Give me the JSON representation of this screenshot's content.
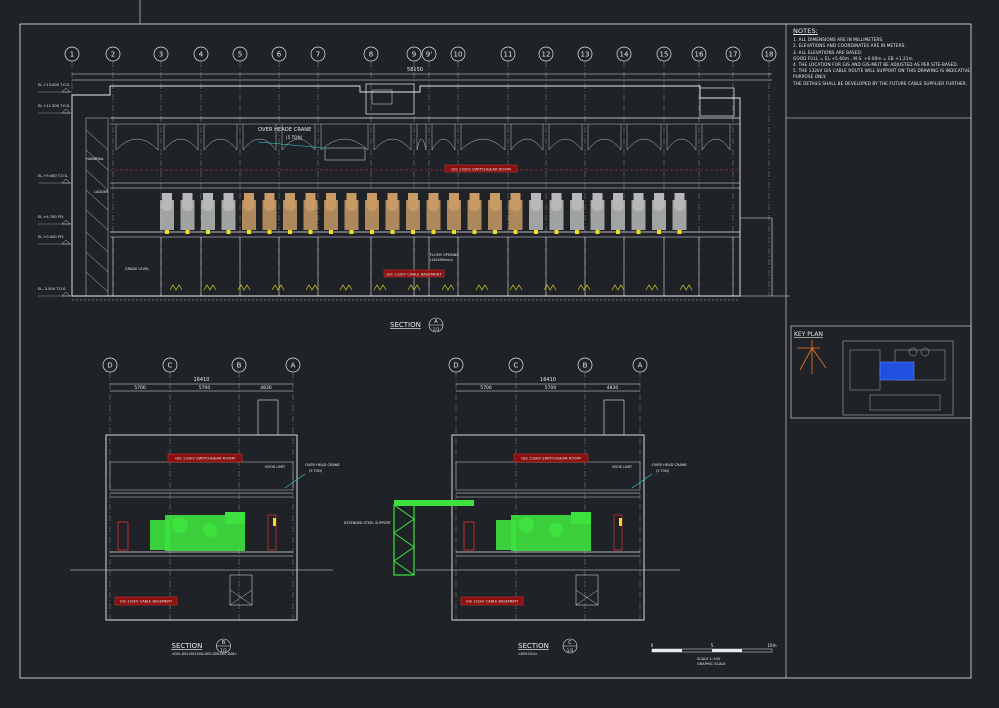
{
  "notes": {
    "heading": "NOTES:",
    "lines": [
      "1. ALL DIMENSIONS ARE IN MILLIMETERS.",
      "2. ELEVATIONS AND COORDINATES ARE IN METERS.",
      "3. ALL ELEVATIONS ARE BASED:",
      "   GOOD FULL = EL.+5.60m , M.S. +0.00m = EB +1.21m",
      "4. THE LOCATION FOR GIS AND GIS-MEIT BE ADJUSTED AS PER SITE-BASED.",
      "5. THE 132kV GIS CABLE ROUTE WILL SUPPORT ON THIS DRAWING IS INDICATIVE",
      "   PURPOSE ONLY.",
      "   THE DETAILS SHALL BE DEVELOPED BY THE FUTURE CABLE SUPPLIER FURTHER."
    ]
  },
  "key_plan": {
    "title": "KEY PLAN"
  },
  "section_a": {
    "grid": [
      "1",
      "2",
      "3",
      "4",
      "5",
      "6",
      "7",
      "8",
      "9",
      "9'",
      "10",
      "11",
      "12",
      "13",
      "14",
      "15",
      "16",
      "17",
      "18"
    ],
    "overall_dim": "58150",
    "title": "SECTION",
    "mark": "A",
    "sheet": "1/3",
    "crane_label": "OVER HEADE CRANE",
    "crane_capacity": "(5 TON)",
    "room_label": "GIS 132kV SWITCHGEAR ROOM",
    "basement_label": "GIS 132kV CABLE BASEMENT",
    "grade_label": "GRADE LEVEL",
    "handrail_label": "HANDRAIL",
    "ladder_label": "LADDER",
    "floor_opening_label": "FLOOR OPENING",
    "floor_opening_size": "(150x500mm)",
    "levels": [
      "EL.+13.000 T.O.S.",
      "EL.+11.300 T.O.S.",
      "EL.+9.450 T.O.S.",
      "EL.+4.700 FFL",
      "EL.+0.000 FFL",
      "EL.-3.500 T.O.S."
    ]
  },
  "section_b": {
    "grid": [
      "D",
      "C",
      "B",
      "A"
    ],
    "overall_dim": "16410",
    "dims": [
      "5700",
      "5700",
      "4830"
    ],
    "title": "SECTION",
    "mark": "B",
    "sheet": "1/3",
    "room_label": "GIS 132kV SWITCHGEAR ROOM",
    "basement_label": "GIS 132kV CABLE BASEMENT",
    "crane_label": "OVER HEAD CRANE",
    "crane_capacity": "(5 TON)",
    "hook_label": "HOOK LIMIT",
    "hook_value": "1100",
    "subtitle": "<D01-D02-D03-D04-D05-D06-D07-D08>"
  },
  "section_c": {
    "grid": [
      "D",
      "C",
      "B",
      "A"
    ],
    "overall_dim": "16410",
    "dims": [
      "5700",
      "5700",
      "4830"
    ],
    "title": "SECTION",
    "mark": "C",
    "sheet": "1/3",
    "room_label": "GIS 132kV SWITCHGEAR ROOM",
    "basement_label": "GIS 132kV CABLE BASEMENT",
    "crane_label": "OVER HEAD CRANE",
    "crane_capacity": "(5 TON)",
    "hook_label": "HOOK LIMIT",
    "subtitle": "<D09-D10>",
    "support_label": "EXTENDED STEEL SUPPORT"
  },
  "scale": {
    "ticks": [
      "0",
      "5",
      "10m"
    ],
    "label": "SCALE 1:100",
    "sub": "GRAPHIC SCALE"
  },
  "colors": {
    "bg": "#1f2327",
    "line": "#e8e8e8",
    "gis_grey": "#b8b8b8",
    "gis_tan": "#c79a66",
    "gis_green": "#3ee23e",
    "red": "#e03030",
    "cyan": "#2fd6d6",
    "yellow": "#e8e020",
    "blue": "#2050e0",
    "orange": "#f07820"
  }
}
